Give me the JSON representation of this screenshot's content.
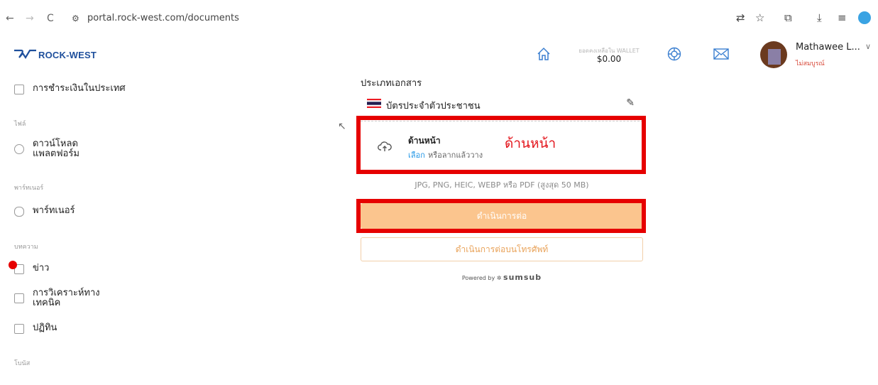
{
  "browser": {
    "back": "←",
    "forward": "→",
    "reload": "C",
    "url": "portal.rock-west.com/documents"
  },
  "logo": {
    "text": "ROCK-WEST",
    "color": "#1e4f9c"
  },
  "sidebar": {
    "domestic_payment": "การชำระเงินในประเทศ",
    "section_files": "ไฟล์",
    "download_platform_line1": "ดาวน์โหลด",
    "download_platform_line2": "แพลตฟอร์ม",
    "section_partners": "พาร์ทเนอร์",
    "partners": "พาร์ทเนอร์",
    "section_articles": "บทความ",
    "news": "ข่าว",
    "analysis_line1": "การวิเคราะห์ทาง",
    "analysis_line2": "เทคนิค",
    "calendar": "ปฏิทิน",
    "section_bonus": "โบนัส"
  },
  "header": {
    "wallet_label": "ยอดคงเหลือใน WALLET",
    "wallet_amount": "$0.00",
    "user_name": "Mathawee L...",
    "user_status": "ไม่สมบูรณ์"
  },
  "main": {
    "doc_type_title": "ประเภทเอกสาร",
    "doc_name": "บัตรประจำตัวประชาชน",
    "upload_title": "ด้านหน้า",
    "upload_choose": "เลือก",
    "upload_drag": "หรือลากแล้ววาง",
    "upload_annotation": "ด้านหน้า",
    "formats": "JPG, PNG, HEIC, WEBP หรือ PDF (สูงสุด 50 MB)",
    "continue_button": "ดำเนินการต่อ",
    "phone_button": "ดำเนินการต่อบนโทรศัพท์",
    "powered_by": "Powered by",
    "powered_brand": "sumsub"
  },
  "colors": {
    "accent_orange": "#fbc58e",
    "link_blue": "#2196e6",
    "highlight_red": "#e60000"
  }
}
